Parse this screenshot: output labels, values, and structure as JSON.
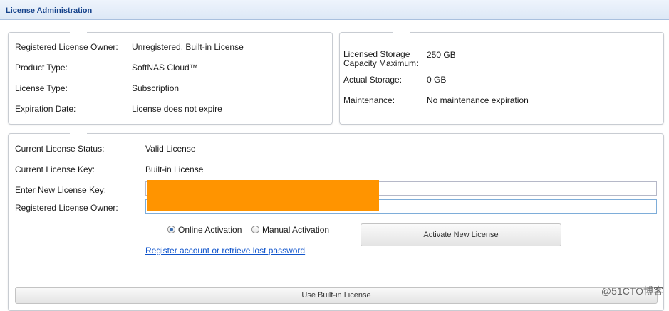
{
  "window": {
    "title": "License Administration"
  },
  "license_info": {
    "rows": [
      {
        "label": "Registered License Owner:",
        "value": "Unregistered, Built-in License"
      },
      {
        "label": "Product Type:",
        "value": "SoftNAS Cloud™"
      },
      {
        "label": "License Type:",
        "value": "Subscription"
      },
      {
        "label": "Expiration Date:",
        "value": "License does not expire"
      }
    ]
  },
  "storage_info": {
    "rows": [
      {
        "label": "Licensed Storage Capacity Maximum:",
        "value": "250 GB"
      },
      {
        "label": "Actual Storage:",
        "value": "0 GB"
      },
      {
        "label": "Maintenance:",
        "value": "No maintenance expiration"
      }
    ]
  },
  "activation": {
    "status_label": "Current License Status:",
    "status_value": "Valid License",
    "key_label": "Current License Key:",
    "key_value": "Built-in License",
    "new_key_label": "Enter New License Key:",
    "new_key_value": "",
    "owner_label": "Registered License Owner:",
    "owner_value": "",
    "redaction_color": "#ff9400",
    "mode_options": [
      {
        "label": "Online Activation",
        "selected": true
      },
      {
        "label": "Manual Activation",
        "selected": false
      }
    ],
    "activate_button": "Activate New License",
    "register_link": "Register account or retrieve lost password",
    "builtin_button": "Use Built-in License"
  },
  "watermark": "@51CTO博客"
}
